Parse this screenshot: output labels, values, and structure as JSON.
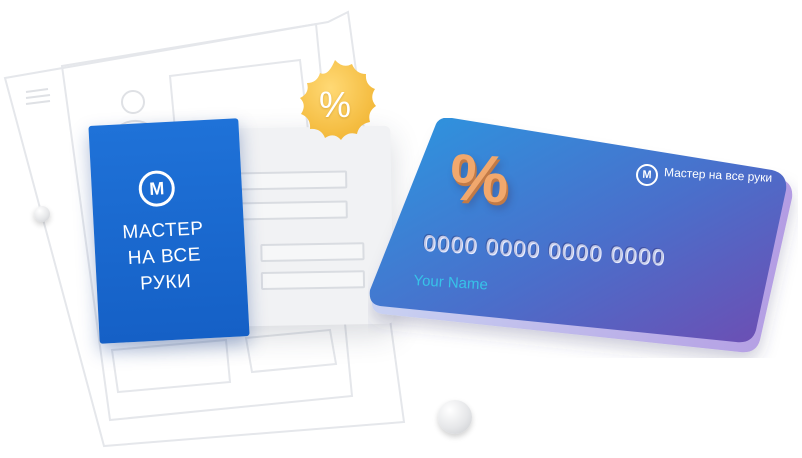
{
  "brand_tag": {
    "logo_letter": "M",
    "text_lines": [
      "МАСТЕР",
      "НА ВСЕ",
      "РУКИ"
    ]
  },
  "badge": {
    "label": "%"
  },
  "card": {
    "percent_label": "%",
    "logo_letter": "M",
    "brand_name": "Мастер на все руки",
    "number": "0000 0000 0000 0000",
    "holder_name": "Your Name"
  },
  "colors": {
    "brand_blue": "#1665cd",
    "badge_orange": "#f7c14a",
    "card_gradient_start": "#2f90de",
    "card_gradient_end": "#6a4fb3",
    "percent_copper": "#f1a86d"
  },
  "icons": {
    "brand_logo": "m-circle-icon",
    "badge_shape": "scalloped-badge-icon",
    "wireframe_avatar": "user-avatar-icon",
    "wireframe_menu": "hamburger-menu-icon"
  }
}
